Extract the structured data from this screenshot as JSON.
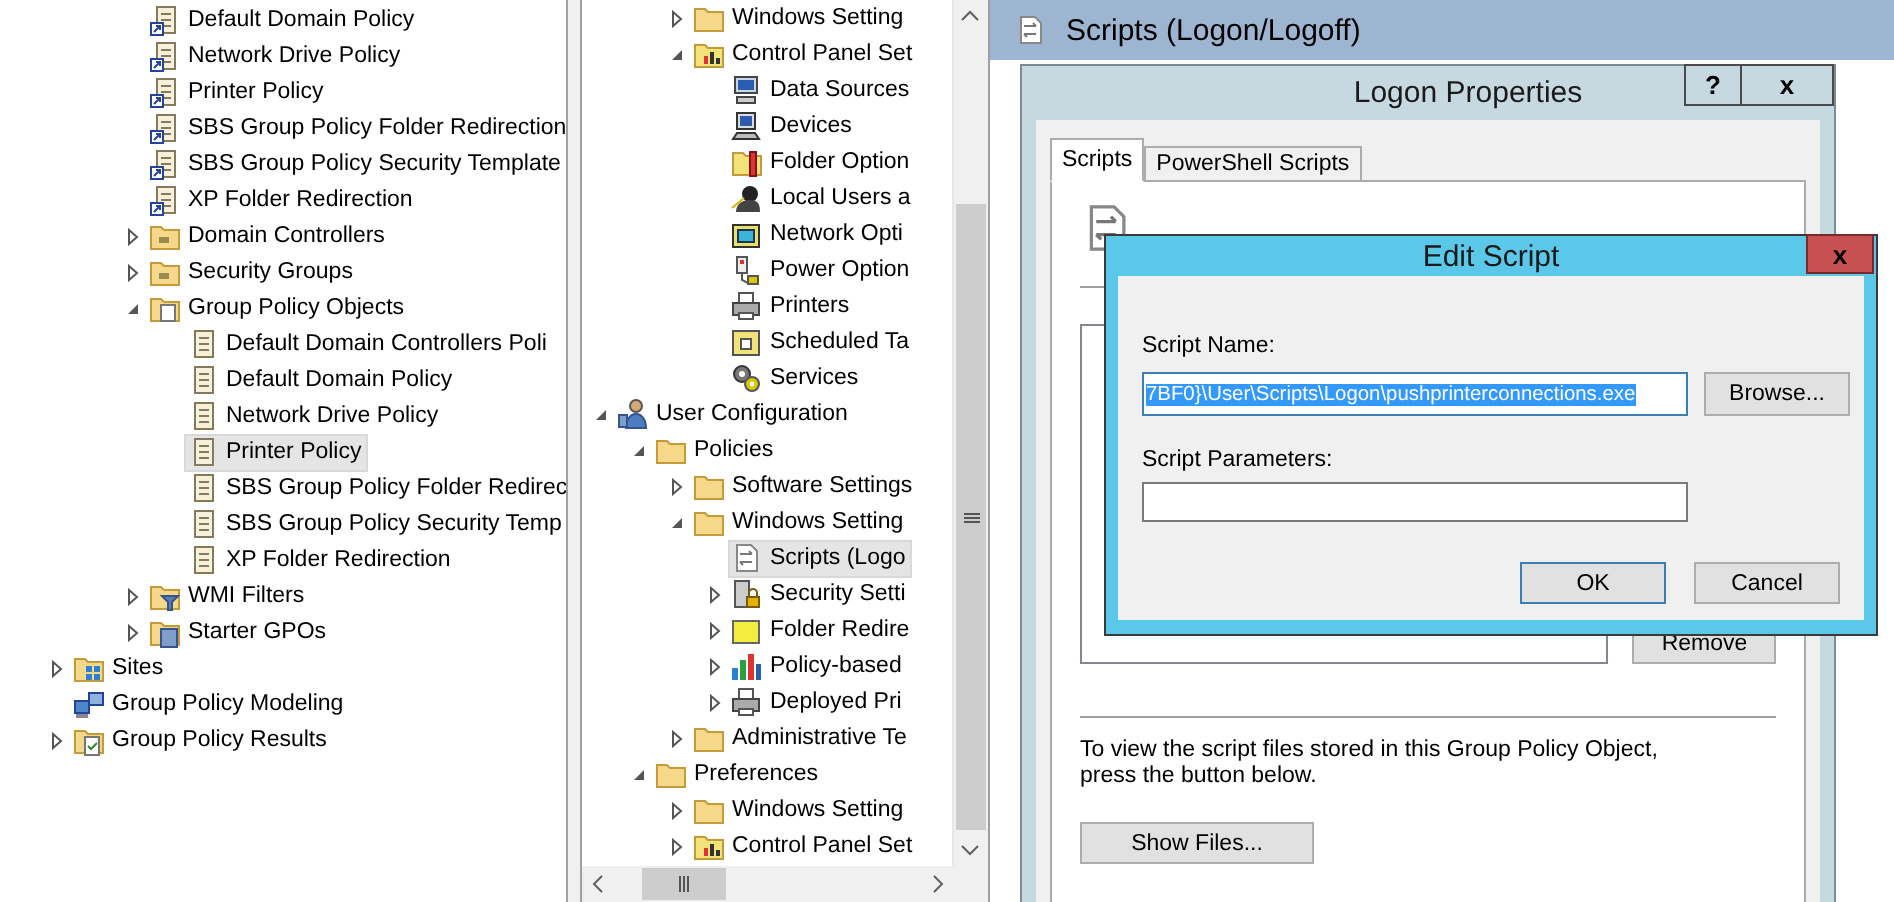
{
  "left_tree": {
    "items": [
      {
        "children": [
          {
            "children": [
              {
                "label": "Default Domain Policy",
                "kind": "gpo-link",
                "selected": false
              },
              {
                "label": "Network Drive Policy",
                "kind": "gpo-link",
                "selected": false
              },
              {
                "label": "Printer Policy",
                "kind": "gpo-link",
                "selected": false
              },
              {
                "label": "SBS Group Policy Folder Redirection",
                "kind": "gpo-link",
                "selected": false
              },
              {
                "label": "SBS Group Policy Security Template",
                "kind": "gpo-link",
                "selected": false
              },
              {
                "label": "XP Folder Redirection",
                "kind": "gpo-link",
                "selected": false
              },
              {
                "label": "Domain Controllers",
                "kind": "ou",
                "expanded": false,
                "selected": false
              },
              {
                "label": "Security Groups",
                "kind": "ou",
                "expanded": false,
                "selected": false
              },
              {
                "label": "Group Policy Objects",
                "kind": "folder-docs",
                "expanded": true,
                "selected": false,
                "children": [
                  {
                    "label": "Default Domain Controllers Poli",
                    "kind": "gpo",
                    "selected": false
                  },
                  {
                    "label": "Default Domain Policy",
                    "kind": "gpo",
                    "selected": false
                  },
                  {
                    "label": "Network Drive Policy",
                    "kind": "gpo",
                    "selected": false
                  },
                  {
                    "label": "Printer Policy",
                    "kind": "gpo",
                    "selected": true
                  },
                  {
                    "label": "SBS Group Policy Folder Redirec",
                    "kind": "gpo",
                    "selected": false
                  },
                  {
                    "label": "SBS Group Policy Security Temp",
                    "kind": "gpo",
                    "selected": false
                  },
                  {
                    "label": "XP Folder Redirection",
                    "kind": "gpo",
                    "selected": false
                  }
                ]
              },
              {
                "label": "WMI Filters",
                "kind": "wmi",
                "expanded": false,
                "selected": false
              },
              {
                "label": "Starter GPOs",
                "kind": "starter",
                "expanded": false,
                "selected": false
              }
            ]
          }
        ]
      },
      {
        "label": "Sites",
        "kind": "sites",
        "expanded": false,
        "selected": false
      },
      {
        "label": "Group Policy Modeling",
        "kind": "modeling",
        "selected": false
      },
      {
        "label": "Group Policy Results",
        "kind": "results",
        "expanded": false,
        "selected": false
      }
    ]
  },
  "middle_tree": {
    "items": [
      {
        "children": [
          {
            "children": [
              {
                "label": "Windows Setting",
                "kind": "folder",
                "expanded": false,
                "selected": false
              },
              {
                "label": "Control Panel Set",
                "kind": "control-panel",
                "expanded": true,
                "selected": false,
                "children": [
                  {
                    "label": "Data Sources",
                    "kind": "datasources",
                    "selected": false
                  },
                  {
                    "label": "Devices",
                    "kind": "computer",
                    "selected": false
                  },
                  {
                    "label": "Folder Option",
                    "kind": "folder-options",
                    "selected": false
                  },
                  {
                    "label": "Local Users a",
                    "kind": "users",
                    "selected": false
                  },
                  {
                    "label": "Network Opti",
                    "kind": "network",
                    "selected": false
                  },
                  {
                    "label": "Power Option",
                    "kind": "power",
                    "selected": false
                  },
                  {
                    "label": "Printers",
                    "kind": "printer",
                    "selected": false
                  },
                  {
                    "label": "Scheduled Ta",
                    "kind": "tasks",
                    "selected": false
                  },
                  {
                    "label": "Services",
                    "kind": "gears",
                    "selected": false
                  }
                ]
              }
            ]
          }
        ]
      },
      {
        "label": "User Configuration",
        "kind": "user",
        "expanded": true,
        "selected": false,
        "children": [
          {
            "label": "Policies",
            "kind": "folder",
            "expanded": true,
            "selected": false,
            "children": [
              {
                "label": "Software Settings",
                "kind": "folder",
                "expanded": false,
                "selected": false
              },
              {
                "label": "Windows Setting",
                "kind": "folder",
                "expanded": true,
                "selected": false,
                "children": [
                  {
                    "label": "Scripts (Logo",
                    "kind": "script",
                    "selected": true
                  },
                  {
                    "label": "Security Setti",
                    "kind": "security",
                    "expanded": false,
                    "selected": false
                  },
                  {
                    "label": "Folder Redire",
                    "kind": "folder-yellow",
                    "expanded": false,
                    "selected": false
                  },
                  {
                    "label": "Policy-based",
                    "kind": "chart",
                    "expanded": false,
                    "selected": false
                  },
                  {
                    "label": "Deployed Pri",
                    "kind": "printer",
                    "expanded": false,
                    "selected": false
                  }
                ]
              },
              {
                "label": "Administrative Te",
                "kind": "folder",
                "expanded": false,
                "selected": false
              }
            ]
          },
          {
            "label": "Preferences",
            "kind": "folder",
            "expanded": true,
            "selected": false,
            "children": [
              {
                "label": "Windows Setting",
                "kind": "folder",
                "expanded": false,
                "selected": false
              },
              {
                "label": "Control Panel Set",
                "kind": "control-panel",
                "expanded": false,
                "selected": false
              }
            ]
          }
        ]
      }
    ]
  },
  "right_pane": {
    "title": "Scripts (Logon/Logoff)"
  },
  "logon_properties": {
    "title": "Logon Properties",
    "help_button": "?",
    "close_button": "x",
    "tabs": [
      {
        "label": "Scripts",
        "selected": true
      },
      {
        "label": "PowerShell Scripts",
        "selected": false
      }
    ],
    "remove_button": "Remove",
    "note": "To view the script files stored in this Group Policy Object, press the button below.",
    "show_files_button": "Show Files..."
  },
  "edit_script": {
    "title": "Edit Script",
    "close_button": "x",
    "script_name_label": "Script Name:",
    "script_name_value": "7BF0}\\User\\Scripts\\Logon\\pushprinterconnections.exe",
    "value_selected": true,
    "browse_button": "Browse...",
    "script_parameters_label": "Script Parameters:",
    "ok_button": "OK",
    "cancel_button": "Cancel"
  }
}
